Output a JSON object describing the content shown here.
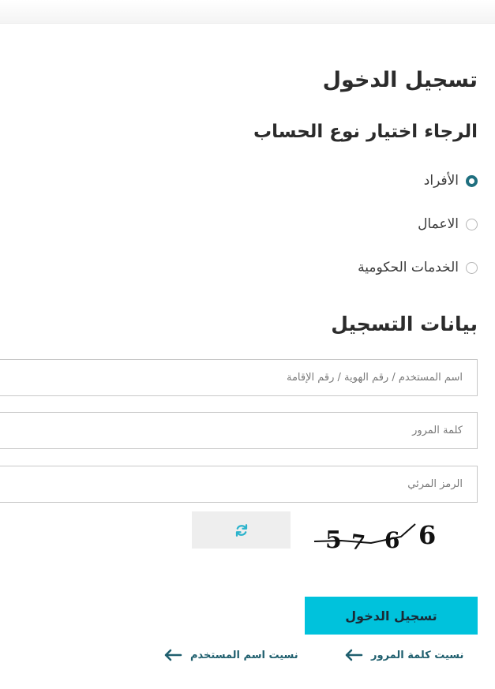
{
  "login": {
    "title": "تسجيل الدخول",
    "account_type_title": "الرجاء اختيار نوع الحساب",
    "account_types": [
      {
        "label": "الأفراد",
        "checked": true
      },
      {
        "label": "الاعمال",
        "checked": false
      },
      {
        "label": "الخدمات الحكومية",
        "checked": false
      }
    ],
    "registration_title": "بيانات التسجيل",
    "username_placeholder": "اسم المستخدم / رقم الهوية / رقم الإقامة",
    "password_placeholder": "كلمة المرور",
    "captcha_placeholder": "الرمز المرئي",
    "captcha_text": "5766",
    "refresh_icon": "refresh-icon",
    "submit_label": "تسجيل الدخول",
    "forgot_password_label": "نسيت كلمة المرور",
    "forgot_username_label": "نسيت اسم المستخدم",
    "colors": {
      "accent": "#00c2dc",
      "radio_checked": "#1f6f7f",
      "link": "#1f5f6e",
      "refresh_icon": "#2bb3cc"
    }
  }
}
